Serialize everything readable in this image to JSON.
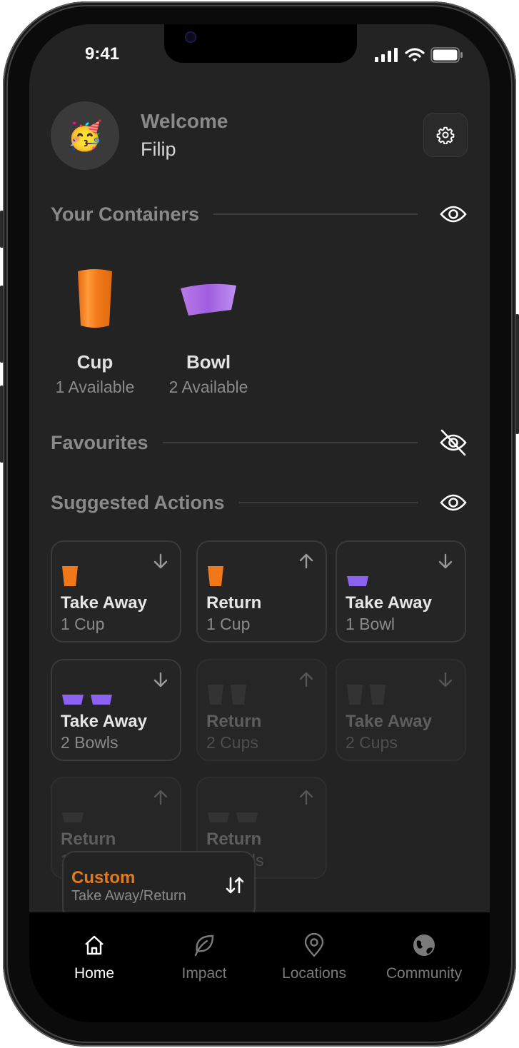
{
  "status_bar": {
    "time": "9:41"
  },
  "header": {
    "avatar_emoji": "🥳",
    "welcome": "Welcome",
    "username": "Filip"
  },
  "sections": {
    "containers": {
      "title": "Your Containers",
      "visibility": "visible"
    },
    "favourites": {
      "title": "Favourites",
      "visibility": "hidden"
    },
    "suggested": {
      "title": "Suggested Actions",
      "visibility": "visible"
    }
  },
  "containers": [
    {
      "name": "Cup",
      "available": "1 Available",
      "color": "#f07818"
    },
    {
      "name": "Bowl",
      "available": "2 Available",
      "color": "#a05ee0"
    }
  ],
  "actions": [
    {
      "title": "Take Away",
      "sub": "1 Cup",
      "direction": "down",
      "item": "cup",
      "count": 1,
      "enabled": true
    },
    {
      "title": "Return",
      "sub": "1 Cup",
      "direction": "up",
      "item": "cup",
      "count": 1,
      "enabled": true
    },
    {
      "title": "Take Away",
      "sub": "1 Bowl",
      "direction": "down",
      "item": "bowl",
      "count": 1,
      "enabled": true
    },
    {
      "title": "Take Away",
      "sub": "2 Bowls",
      "direction": "down",
      "item": "bowl",
      "count": 2,
      "enabled": true
    },
    {
      "title": "Return",
      "sub": "2 Cups",
      "direction": "up",
      "item": "cup",
      "count": 2,
      "enabled": false
    },
    {
      "title": "Take Away",
      "sub": "2 Cups",
      "direction": "down",
      "item": "cup",
      "count": 2,
      "enabled": false
    },
    {
      "title": "Return",
      "sub": "1 Bowl",
      "direction": "up",
      "item": "bowl",
      "count": 1,
      "enabled": false
    },
    {
      "title": "Return",
      "sub": "2 Bowls",
      "direction": "up",
      "item": "bowl",
      "count": 2,
      "enabled": false
    }
  ],
  "custom": {
    "title": "Custom",
    "sub": "Take Away/Return"
  },
  "nav": [
    {
      "label": "Home",
      "icon": "home-icon",
      "active": true
    },
    {
      "label": "Impact",
      "icon": "leaf-icon",
      "active": false
    },
    {
      "label": "Locations",
      "icon": "location-pin-icon",
      "active": false
    },
    {
      "label": "Community",
      "icon": "globe-icon",
      "active": false
    }
  ],
  "colors": {
    "cup": "#f07818",
    "bowl": "#8b62f0",
    "accent": "#e07a1a",
    "disabled_icon": "#333333"
  }
}
